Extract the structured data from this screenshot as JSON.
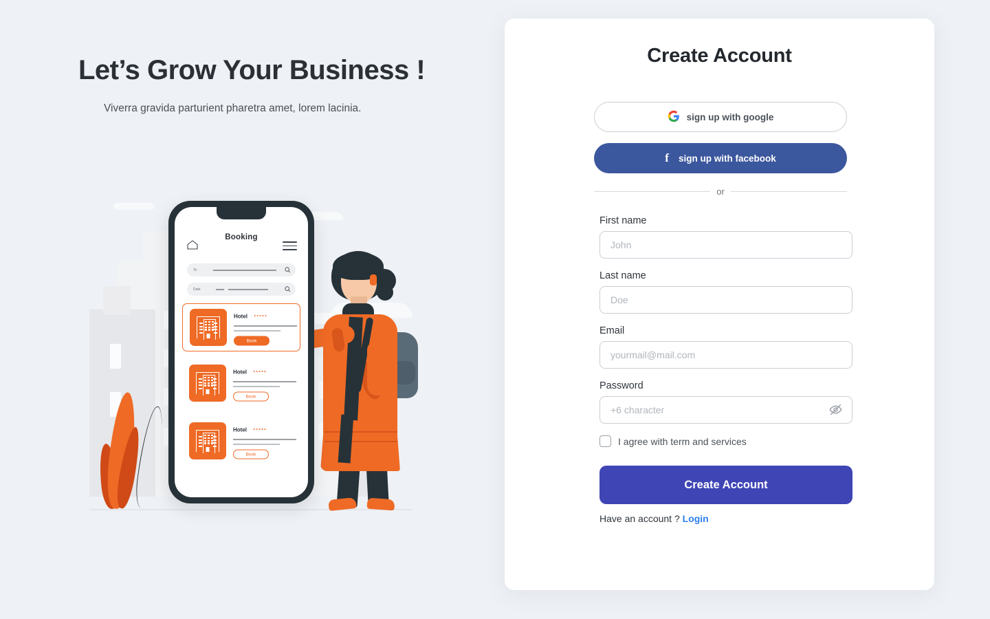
{
  "page": {
    "background_color": "#eef1f5"
  },
  "hero": {
    "title": "Let’s Grow Your Business !",
    "subtitle": "Viverra gravida parturient pharetra amet, lorem lacinia."
  },
  "illustration": {
    "phone_app": {
      "home_icon": "home-icon",
      "menu_icon": "hamburger-menu-icon",
      "title": "Booking",
      "search_fields": [
        {
          "label": "To",
          "icon": "search-icon"
        },
        {
          "label": "Date",
          "icon": "search-icon"
        }
      ],
      "hotels": [
        {
          "name": "Hotel",
          "stars": "•••••",
          "button": "Book",
          "selected": true
        },
        {
          "name": "Hotel",
          "stars": "•••••",
          "button": "Book",
          "selected": false
        },
        {
          "name": "Hotel",
          "stars": "•••••",
          "button": "Book",
          "selected": false
        }
      ]
    },
    "character": "woman-in-orange-coat-with-backpack-pointing-at-phone",
    "accent_color": "#ef6a25"
  },
  "card": {
    "title": "Create Account",
    "social_buttons": [
      {
        "label": "sign up with google",
        "icon": "google-icon",
        "style": "outline"
      },
      {
        "label": "sign up with facebook",
        "icon": "facebook-icon",
        "style": "filled",
        "color": "#3b579d"
      }
    ],
    "divider_text": "or",
    "fields": [
      {
        "label": "First name",
        "placeholder": "John",
        "value": "",
        "type": "text"
      },
      {
        "label": "Last name",
        "placeholder": "Doe",
        "value": "",
        "type": "text"
      },
      {
        "label": "Email",
        "placeholder": "yourmail@mail.com",
        "value": "",
        "type": "email"
      },
      {
        "label": "Password",
        "placeholder": "+6 character",
        "value": "",
        "type": "password",
        "toggle_icon": "eye-off-icon"
      }
    ],
    "terms": {
      "label": "I agree with term and services",
      "checked": false
    },
    "submit_label": "Create Account",
    "submit_color": "#3f45b5",
    "footer": {
      "text": "Have an account ?",
      "link_label": "Login",
      "link_color": "#2d7ff0"
    }
  }
}
